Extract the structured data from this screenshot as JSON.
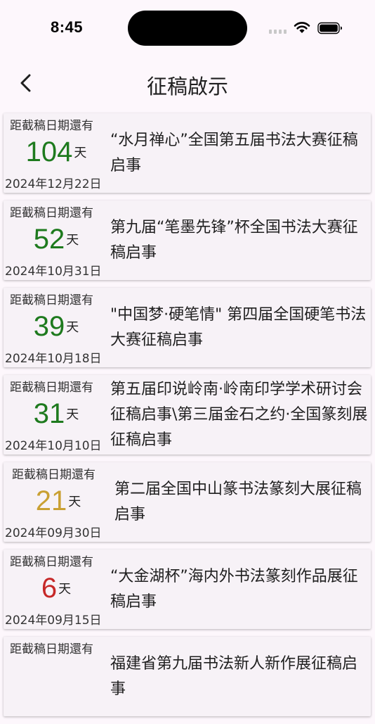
{
  "status_bar": {
    "time": "8:45"
  },
  "header": {
    "title": "征稿啟示"
  },
  "colors": {
    "green": "#1e7a1e",
    "gold": "#c9a033",
    "red": "#c62828"
  },
  "notices": [
    {
      "label": "距截稿日期還有",
      "days": "104",
      "unit": "天",
      "date": "2024年12月22日",
      "title": "“水月禅心”全国第五届书法大赛征稿启事",
      "color": "#1e7a1e"
    },
    {
      "label": "距截稿日期還有",
      "days": "52",
      "unit": "天",
      "date": "2024年10月31日",
      "title": "第九届“笔墨先锋”杯全国书法大赛征稿启事",
      "color": "#1e7a1e"
    },
    {
      "label": "距截稿日期還有",
      "days": "39",
      "unit": "天",
      "date": "2024年10月18日",
      "title": "\"中国梦·硬笔情\" 第四届全国硬笔书法大赛征稿启事",
      "color": "#1e7a1e"
    },
    {
      "label": "距截稿日期還有",
      "days": "31",
      "unit": "天",
      "date": "2024年10月10日",
      "title": "第五届印说岭南·岭南印学学术研讨会征稿启事\\第三届金石之约·全国篆刻展征稿启事",
      "color": "#1e7a1e"
    },
    {
      "label": "距截稿日期還有",
      "days": "21",
      "unit": "天",
      "date": "2024年09月30日",
      "title": "第二届全国中山篆书法篆刻大展征稿启事",
      "color": "#c9a033"
    },
    {
      "label": "距截稿日期還有",
      "days": "6",
      "unit": "天",
      "date": "2024年09月15日",
      "title": "“大金湖杯”海内外书法篆刻作品展征稿启事",
      "color": "#c62828"
    },
    {
      "label": "距截稿日期還有",
      "days": "",
      "unit": "",
      "date": "",
      "title": "福建省第九届书法新人新作展征稿启事",
      "color": "#c62828"
    }
  ]
}
